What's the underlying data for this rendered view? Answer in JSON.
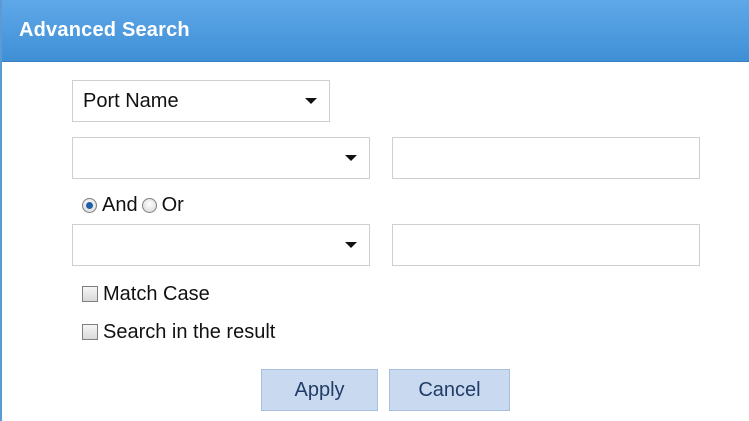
{
  "dialog": {
    "title": "Advanced Search"
  },
  "field_select": {
    "value": "Port Name"
  },
  "row1": {
    "operator_value": "",
    "text_value": ""
  },
  "logic": {
    "and_label": "And",
    "or_label": "Or",
    "selected": "And"
  },
  "row2": {
    "operator_value": "",
    "text_value": ""
  },
  "options": {
    "match_case_label": "Match Case",
    "search_in_result_label": "Search in the result"
  },
  "buttons": {
    "apply_label": "Apply",
    "cancel_label": "Cancel"
  },
  "colors": {
    "titlebar": "#3f8fd6",
    "button_bg": "#c9daf0",
    "border_accent": "#5b9bd5"
  }
}
